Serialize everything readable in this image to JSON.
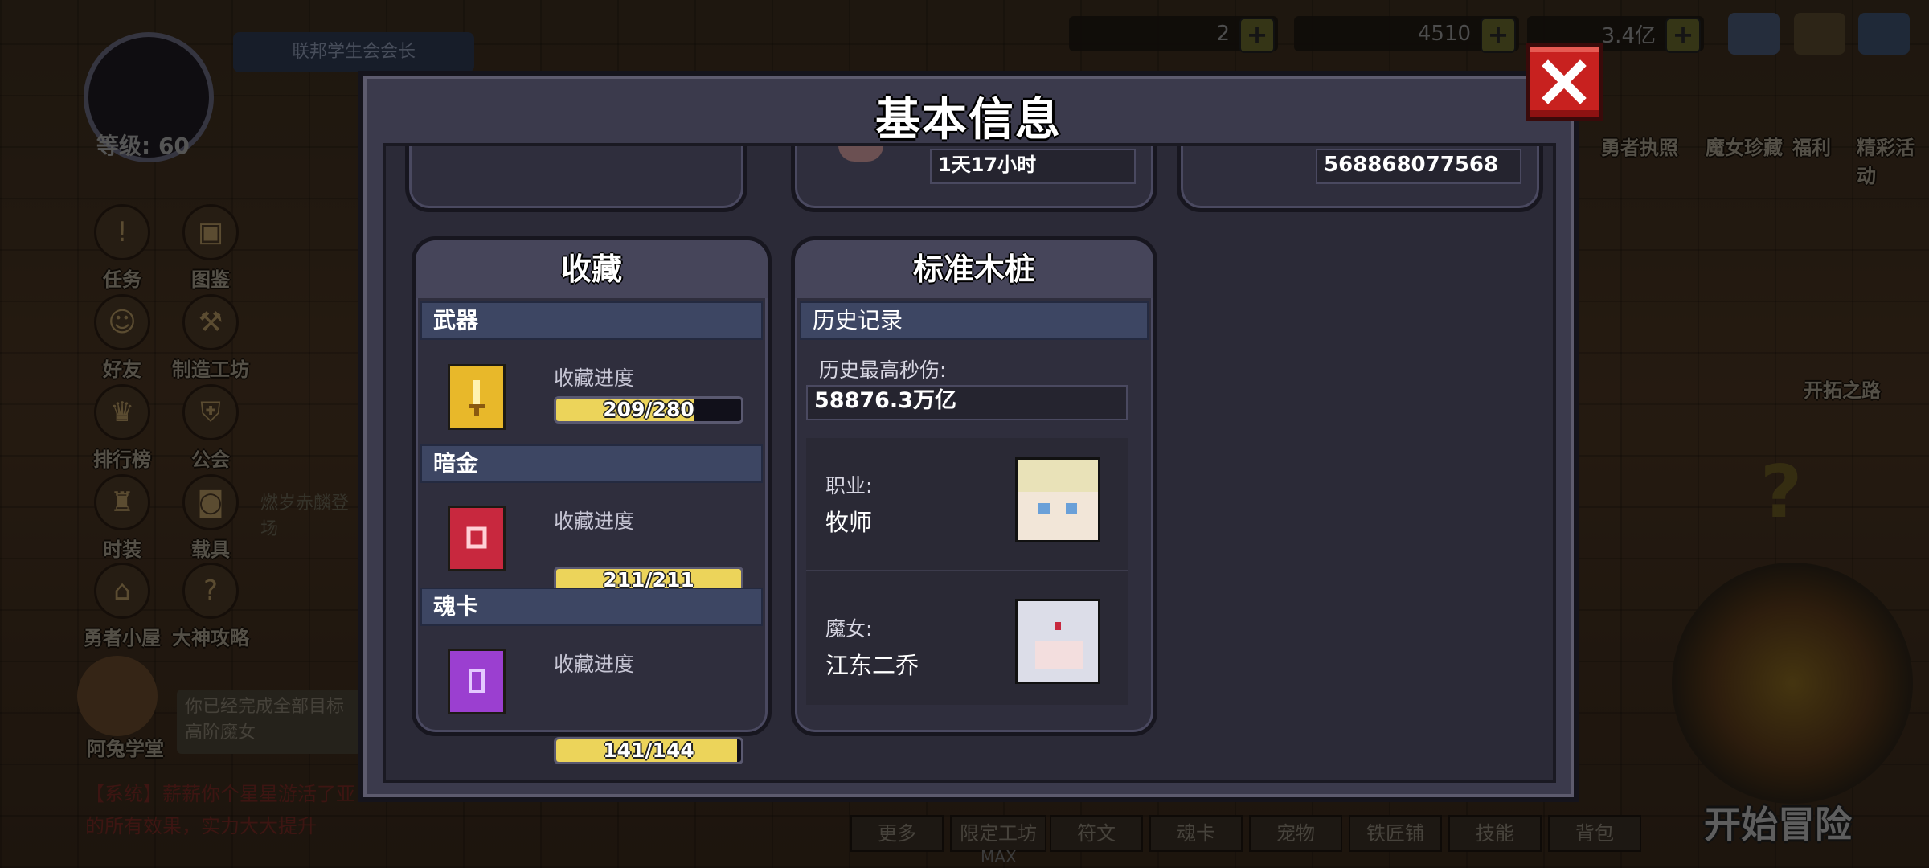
{
  "hud": {
    "player_title": "联邦学生会会长",
    "level_label": "等级: 60",
    "resources": [
      {
        "name": "hearts",
        "value": "2"
      },
      {
        "name": "gems",
        "value": "4510"
      },
      {
        "name": "gold",
        "value": "3.4亿"
      }
    ],
    "right_icons": [
      "勇者执照",
      "魔女珍藏",
      "福利",
      "精彩活动"
    ],
    "left_menu": [
      "任务",
      "图鉴",
      "好友",
      "制造工坊",
      "排行榜",
      "公会",
      "时装",
      "载具",
      "勇者小屋",
      "大神攻略"
    ],
    "event_text": "燃岁赤麟登场",
    "assistant_name": "阿兔学堂",
    "assistant_speech": "你已经完成全部目标高阶魔女",
    "system_msg": "【系统】薪薪你个星星游活了亚的所有效果，实力大大提升",
    "path_btn": "开拓之路",
    "start_btn": "开始冒险",
    "bottom_tabs": [
      "更多",
      "限定工坊",
      "符文",
      "魂卡",
      "宠物",
      "铁匠铺",
      "技能",
      "背包"
    ],
    "max_label": "MAX"
  },
  "modal": {
    "title": "基本信息",
    "top_row": {
      "card2_value": "1天17小时",
      "card3_value": "568868077568"
    },
    "collection": {
      "title": "收藏",
      "sections": [
        {
          "name": "武器",
          "progress_label": "收藏进度",
          "progress_text": "209/280",
          "fraction": 0.746,
          "color": "#e8b82a"
        },
        {
          "name": "暗金",
          "progress_label": "收藏进度",
          "progress_text": "211/211",
          "fraction": 1.0,
          "color": "#c8283e"
        },
        {
          "name": "魂卡",
          "progress_label": "收藏进度",
          "progress_text": "141/144",
          "fraction": 0.979,
          "color": "#9b3fd0"
        }
      ]
    },
    "dummy": {
      "title": "标准木桩",
      "history_header": "历史记录",
      "max_dps_label": "历史最高秒伤:",
      "max_dps_value": "58876.3万亿",
      "class_label": "职业:",
      "class_value": "牧师",
      "witch_label": "魔女:",
      "witch_value": "江东二乔"
    }
  }
}
